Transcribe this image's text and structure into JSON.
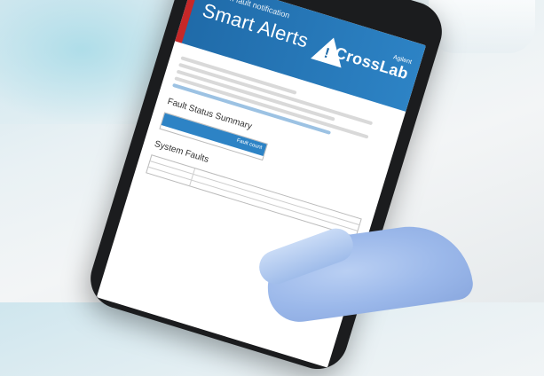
{
  "banner": {
    "subtitle": "System fault notification",
    "title": "Smart Alerts",
    "brand": {
      "top": "Agilent",
      "name": "CrossLab",
      "tagline": ""
    }
  },
  "sections": {
    "fault_summary_title": "Fault Status Summary",
    "system_faults_title": "System Faults"
  },
  "summary_table": {
    "headers": [
      "",
      "Fault count"
    ],
    "rows": [
      [
        "",
        ""
      ]
    ]
  },
  "fault_rows": [
    {
      "left": "",
      "right": ""
    },
    {
      "left": "",
      "right": ""
    },
    {
      "left": "",
      "right": ""
    }
  ],
  "colors": {
    "banner": "#2d83c5",
    "stripe": "#c62828",
    "link": "#1f6aa8"
  }
}
